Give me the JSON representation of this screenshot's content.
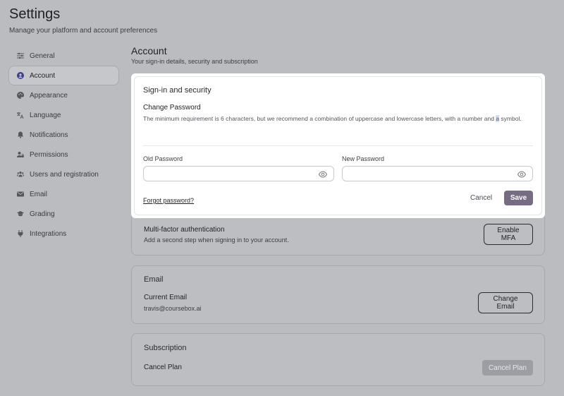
{
  "header": {
    "title": "Settings",
    "subtitle": "Manage your platform and account preferences"
  },
  "sidebar": {
    "items": [
      {
        "label": "General",
        "icon": "sliders-icon"
      },
      {
        "label": "Account",
        "icon": "user-circle-icon",
        "active": true
      },
      {
        "label": "Appearance",
        "icon": "palette-icon"
      },
      {
        "label": "Language",
        "icon": "translate-icon"
      },
      {
        "label": "Notifications",
        "icon": "bell-icon"
      },
      {
        "label": "Permissions",
        "icon": "user-lock-icon"
      },
      {
        "label": "Users and registration",
        "icon": "users-icon"
      },
      {
        "label": "Email",
        "icon": "mail-icon"
      },
      {
        "label": "Grading",
        "icon": "graduation-cap-icon"
      },
      {
        "label": "Integrations",
        "icon": "plug-icon"
      }
    ]
  },
  "account": {
    "title": "Account",
    "description": "Your sign-in details, security and subscription"
  },
  "security": {
    "title": "Sign-in and security",
    "change_password_label": "Change Password",
    "help_text_before": "The minimum requirement is 6 characters, but we recommend a combination of uppercase and lowercase letters, with a number and ",
    "help_text_highlight": "a",
    "help_text_after": " symbol.",
    "old_password_label": "Old Password",
    "old_password_value": "",
    "new_password_label": "New Password",
    "new_password_value": "",
    "forgot_password": "Forgot password?",
    "cancel_label": "Cancel",
    "save_label": "Save"
  },
  "mfa": {
    "title": "Multi-factor authentication",
    "description": "Add a second step when signing in to your account.",
    "button_label": "Enable MFA"
  },
  "email": {
    "title": "Email",
    "current_label": "Current Email",
    "current_value": "travis@coursebox.ai",
    "button_label": "Change Email"
  },
  "subscription": {
    "title": "Subscription",
    "cancel_plan_label": "Cancel Plan",
    "button_label": "Cancel Plan"
  },
  "colors": {
    "overlay_background": "#bbbcbf",
    "accent": "#766d85",
    "highlight": "#cfe0f7"
  }
}
